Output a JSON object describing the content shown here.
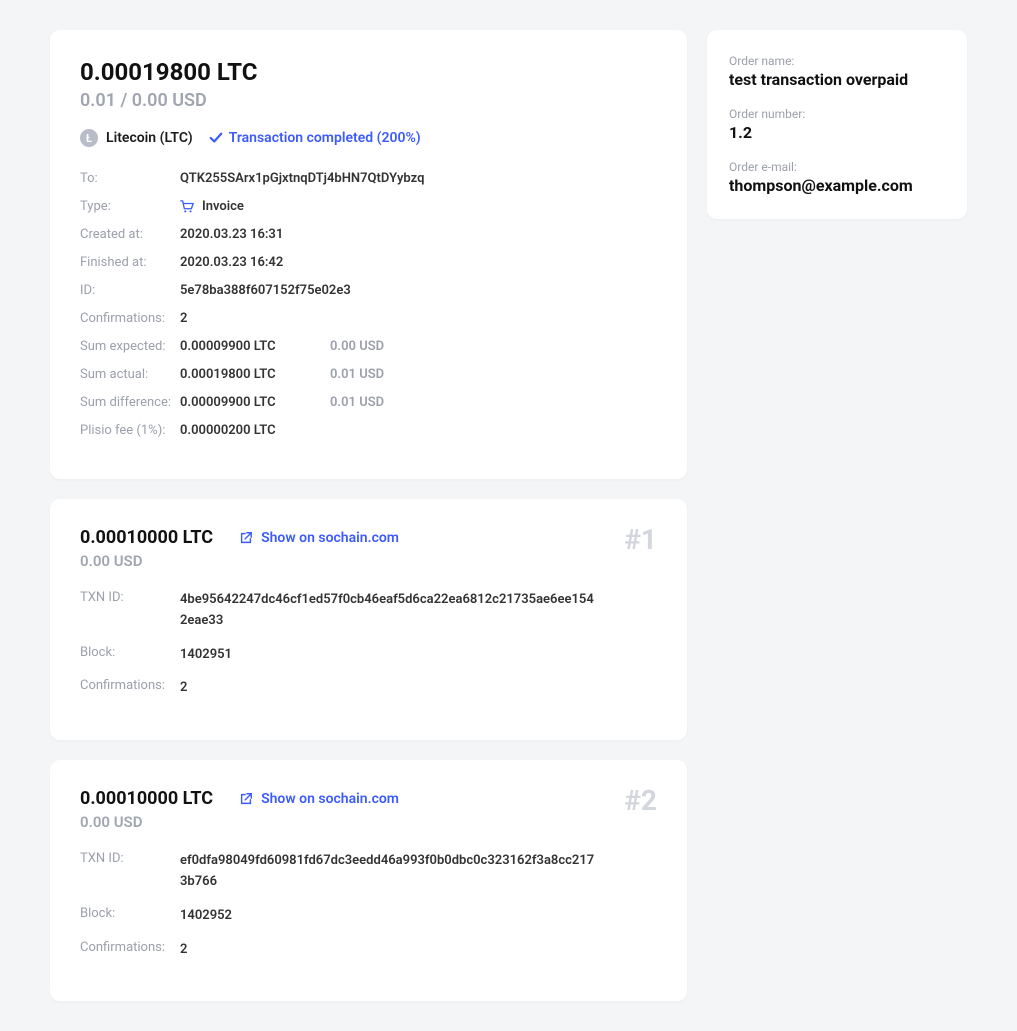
{
  "main": {
    "amount": "0.00019800 LTC",
    "usd": "0.01 / 0.00 USD",
    "coin_name": "Litecoin (LTC)",
    "coin_glyph": "Ł",
    "status": "Transaction completed (200%)",
    "details": {
      "to_label": "To:",
      "to_value": "QTK255SArx1pGjxtnqDTj4bHN7QtDYybzq",
      "type_label": "Type:",
      "type_value": "Invoice",
      "created_label": "Created at:",
      "created_value": "2020.03.23 16:31",
      "finished_label": "Finished at:",
      "finished_value": "2020.03.23 16:42",
      "id_label": "ID:",
      "id_value": "5e78ba388f607152f75e02e3",
      "confirmations_label": "Confirmations:",
      "confirmations_value": "2",
      "sum_expected_label": "Sum expected:",
      "sum_expected_ltc": "0.00009900 LTC",
      "sum_expected_usd": "0.00 USD",
      "sum_actual_label": "Sum actual:",
      "sum_actual_ltc": "0.00019800 LTC",
      "sum_actual_usd": "0.01 USD",
      "sum_diff_label": "Sum difference:",
      "sum_diff_ltc": "0.00009900 LTC",
      "sum_diff_usd": "0.01 USD",
      "fee_label": "Plisio fee (1%):",
      "fee_value": "0.00000200 LTC"
    }
  },
  "transactions": [
    {
      "amount": "0.00010000 LTC",
      "usd": "0.00 USD",
      "number": "#1",
      "link_text": "Show on sochain.com",
      "txn_id_label": "TXN ID:",
      "txn_id": "4be95642247dc46cf1ed57f0cb46eaf5d6ca22ea6812c21735ae6ee1542eae33",
      "block_label": "Block:",
      "block": "1402951",
      "confirmations_label": "Confirmations:",
      "confirmations": "2"
    },
    {
      "amount": "0.00010000 LTC",
      "usd": "0.00 USD",
      "number": "#2",
      "link_text": "Show on sochain.com",
      "txn_id_label": "TXN ID:",
      "txn_id": "ef0dfa98049fd60981fd67dc3eedd46a993f0b0dbc0c323162f3a8cc2173b766",
      "block_label": "Block:",
      "block": "1402952",
      "confirmations_label": "Confirmations:",
      "confirmations": "2"
    }
  ],
  "sidebar": {
    "order_name_label": "Order name:",
    "order_name": "test transaction overpaid",
    "order_number_label": "Order number:",
    "order_number": "1.2",
    "order_email_label": "Order e-mail:",
    "order_email": "thompson@example.com"
  }
}
